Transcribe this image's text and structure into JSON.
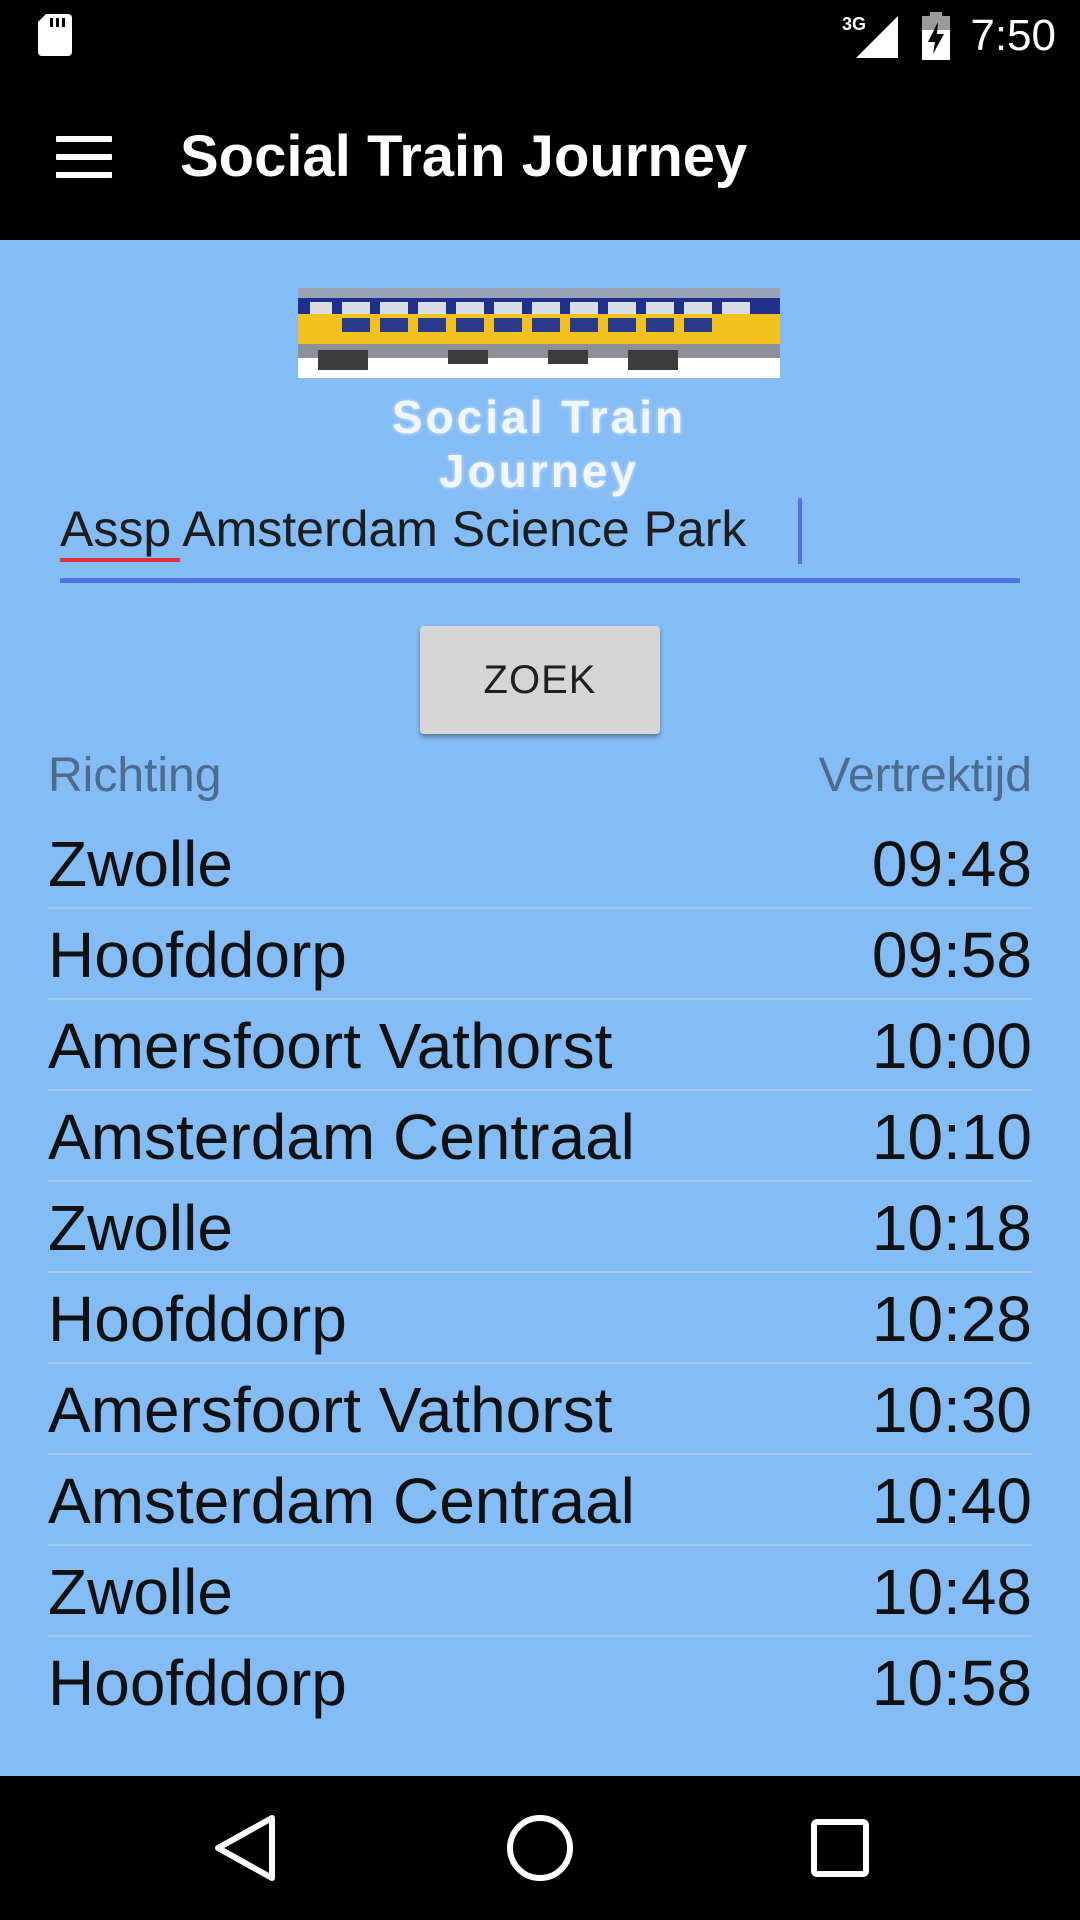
{
  "status_bar": {
    "time": "7:50",
    "network": "3G",
    "icons": [
      "sd-card-icon",
      "signal-icon",
      "battery-charging-icon"
    ]
  },
  "app_bar": {
    "title": "Social Train Journey",
    "menu_icon": "hamburger-menu-icon"
  },
  "logo": {
    "text": "Social Train Journey"
  },
  "search": {
    "value": "Assp Amsterdam Science Park"
  },
  "zoek_button": {
    "label": "ZOEK"
  },
  "table": {
    "headers": [
      "Richting",
      "Vertrektijd"
    ],
    "rows": [
      {
        "destination": "Zwolle",
        "time": "09:48"
      },
      {
        "destination": "Hoofddorp",
        "time": "09:58"
      },
      {
        "destination": "Amersfoort Vathorst",
        "time": "10:00"
      },
      {
        "destination": "Amsterdam Centraal",
        "time": "10:10"
      },
      {
        "destination": "Zwolle",
        "time": "10:18"
      },
      {
        "destination": "Hoofddorp",
        "time": "10:28"
      },
      {
        "destination": "Amersfoort Vathorst",
        "time": "10:30"
      },
      {
        "destination": "Amsterdam Centraal",
        "time": "10:40"
      },
      {
        "destination": "Zwolle",
        "time": "10:48"
      },
      {
        "destination": "Hoofddorp",
        "time": "10:58"
      }
    ]
  },
  "nav_bar": {
    "icons": [
      "back-icon",
      "home-icon",
      "recent-apps-icon"
    ]
  },
  "colors": {
    "content_background": "#84bcf5",
    "accent": "#4f72e6",
    "spell_error": "#e0303a",
    "button": "#d6d6d6"
  }
}
